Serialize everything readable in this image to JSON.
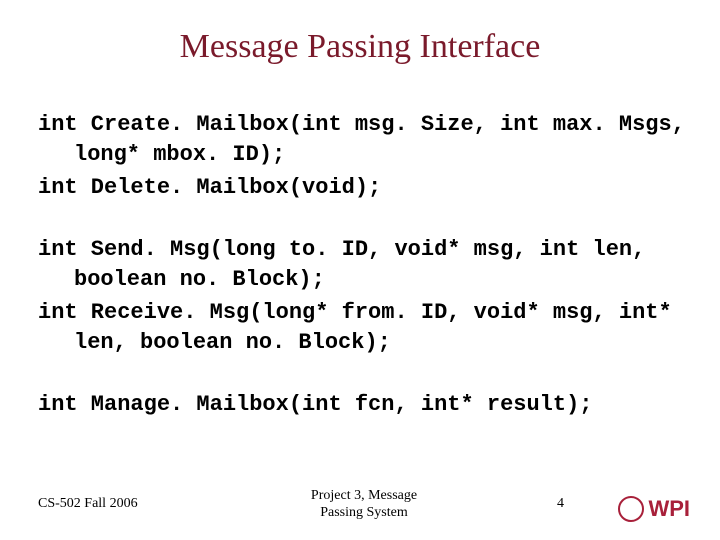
{
  "title": "Message Passing Interface",
  "code": {
    "l1": "int Create. Mailbox(int msg. Size, int max. Msgs, long* mbox. ID);",
    "l2": "int Delete. Mailbox(void);",
    "l3": "int Send. Msg(long to. ID, void* msg, int len, boolean no. Block);",
    "l4": "int Receive. Msg(long* from. ID, void* msg, int* len, boolean no. Block);",
    "l5": "int Manage. Mailbox(int fcn, int* result);"
  },
  "footer": {
    "left": "CS-502 Fall 2006",
    "center_line1": "Project 3, Message",
    "center_line2": "Passing System",
    "page": "4",
    "logo_text": "WPI"
  }
}
